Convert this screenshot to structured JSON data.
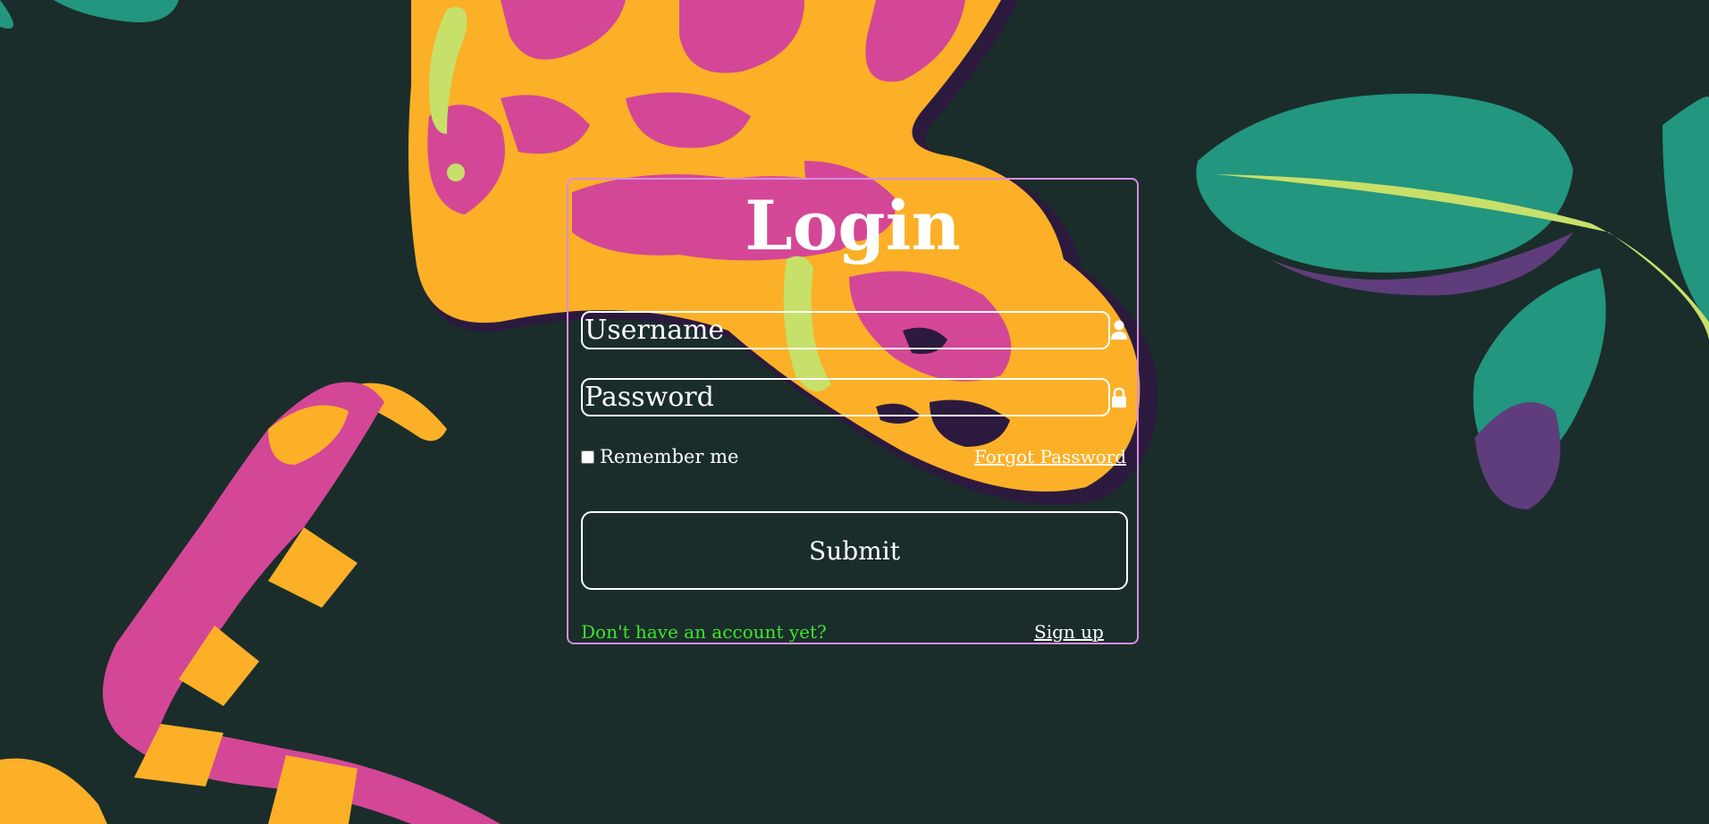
{
  "login": {
    "title": "Login",
    "username_placeholder": "Username",
    "password_placeholder": "Password",
    "remember_label": "Remember me",
    "forgot_label": "Forgot Password",
    "submit_label": "Submit",
    "no_account_text": "Don't have an account yet?",
    "signup_label": "Sign up"
  },
  "icons": {
    "username": "user-icon",
    "password": "lock-icon"
  },
  "colors": {
    "background": "#1a2d2b",
    "box_border": "#d98ce0",
    "text": "#ffffff",
    "no_account_text": "#3ee628",
    "snake_orange": "#fbb027",
    "snake_pink": "#d44796",
    "snake_lime": "#c7e06a",
    "leaf_teal": "#22967e",
    "leaf_purple": "#5f3d7c"
  }
}
